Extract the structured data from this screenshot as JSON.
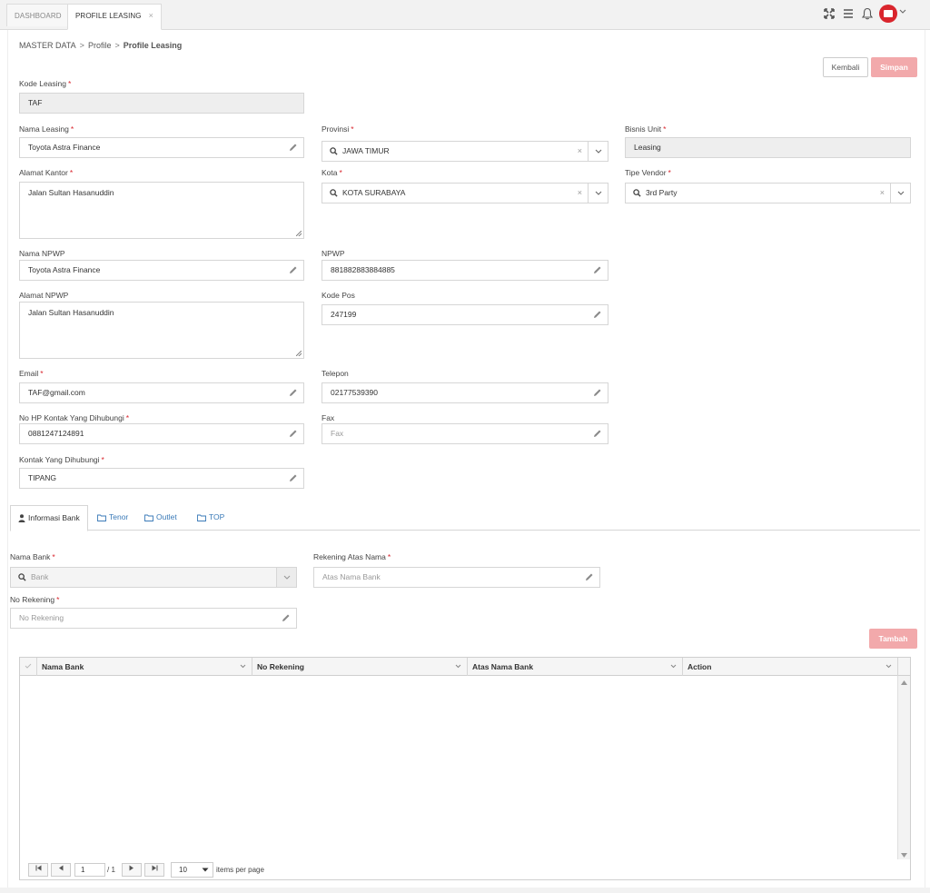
{
  "topbar": {
    "tabs": [
      {
        "label": "DASHBOARD"
      },
      {
        "label": "PROFILE LEASING",
        "close": "×"
      }
    ]
  },
  "breadcrumb": {
    "items": [
      "MASTER DATA",
      "Profile",
      "Profile Leasing"
    ],
    "separator": ">"
  },
  "actions": {
    "back_label": "Kembali",
    "save_label": "Simpan"
  },
  "required_mark": "*",
  "form": {
    "kode_leasing": {
      "label": "Kode Leasing",
      "value": "TAF"
    },
    "nama_leasing": {
      "label": "Nama Leasing",
      "value": "Toyota Astra Finance"
    },
    "alamat_kantor": {
      "label": "Alamat Kantor",
      "value": "Jalan Sultan Hasanuddin"
    },
    "nama_npwp": {
      "label": "Nama NPWP",
      "value": "Toyota Astra Finance"
    },
    "alamat_npwp": {
      "label": "Alamat NPWP",
      "value": "Jalan Sultan Hasanuddin"
    },
    "email": {
      "label": "Email",
      "value": "TAF@gmail.com"
    },
    "no_hp": {
      "label": "No HP Kontak Yang Dihubungi",
      "value": "0881247124891"
    },
    "kontak": {
      "label": "Kontak Yang Dihubungi",
      "value": "TIPANG"
    },
    "provinsi": {
      "label": "Provinsi",
      "value": "JAWA TIMUR",
      "clear": "×"
    },
    "kota": {
      "label": "Kota",
      "value": "KOTA SURABAYA",
      "clear": "×"
    },
    "npwp": {
      "label": "NPWP",
      "value": "881882883884885"
    },
    "kode_pos": {
      "label": "Kode Pos",
      "value": "247199"
    },
    "telepon": {
      "label": "Telepon",
      "value": "02177539390"
    },
    "fax": {
      "label": "Fax",
      "placeholder": "Fax"
    },
    "bisnis_unit": {
      "label": "Bisnis Unit",
      "value": "Leasing"
    },
    "tipe_vendor": {
      "label": "Tipe Vendor",
      "value": "3rd Party",
      "clear": "×"
    }
  },
  "tabs": [
    {
      "label": "Informasi Bank",
      "icon": "user-icon"
    },
    {
      "label": "Tenor",
      "icon": "folder-icon"
    },
    {
      "label": "Outlet",
      "icon": "folder-icon"
    },
    {
      "label": "TOP",
      "icon": "folder-icon"
    }
  ],
  "bank": {
    "nama_bank": {
      "label": "Nama Bank",
      "placeholder": "Bank"
    },
    "rekening_atas_nama": {
      "label": "Rekening Atas Nama",
      "placeholder": "Atas Nama Bank"
    },
    "no_rekening": {
      "label": "No Rekening",
      "placeholder": "No Rekening"
    },
    "add_label": "Tambah"
  },
  "grid": {
    "columns": [
      "Nama Bank",
      "No Rekening",
      "Atas Nama Bank",
      "Action"
    ],
    "pager": {
      "page": "1",
      "total": "/ 1",
      "page_size": "10",
      "items_label": "items per page"
    }
  },
  "colors": {
    "accent": "#d9252d",
    "primary_disabled": "#f2a9ab",
    "link": "#3a7ab8"
  }
}
